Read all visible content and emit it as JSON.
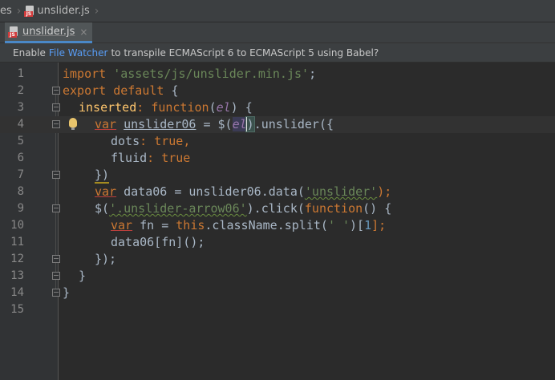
{
  "breadcrumb": {
    "parent": "es",
    "file": "unslider.js",
    "file_icon": "javascript-file-icon",
    "file_badge": "JS"
  },
  "tab": {
    "label": "unslider.js",
    "close": "×"
  },
  "notification": {
    "prefix": "Enable",
    "link": "File Watcher",
    "suffix": "to transpile ECMAScript 6 to ECMAScript 5 using Babel?"
  },
  "editor": {
    "line_numbers": [
      "1",
      "2",
      "3",
      "4",
      "5",
      "6",
      "7",
      "8",
      "9",
      "10",
      "11",
      "12",
      "13",
      "14",
      "15"
    ],
    "current_line": 4,
    "tokens": {
      "l1_import": "import",
      "l1_path": "'assets/js/unslider.min.js'",
      "l2_export": "export",
      "l2_default": "default",
      "l2_brace": "{",
      "l3_inserted": "inserted",
      "l3_colon": ":",
      "l3_function": "function",
      "l3_param": "el",
      "l3_rest": ") {",
      "l4_var": "var",
      "l4_name": "unslider06",
      "l4_eq": " = $(",
      "l4_el": "el",
      "l4_close": ")",
      "l4_call": ".unslider",
      "l4_open": "({",
      "l5_dots": "dots",
      "l5_true": "true",
      "l6_fluid": "fluid",
      "l6_true": "true",
      "l7_close": "})",
      "l8_var": "var",
      "l8_rest": " data06 = unslider06.",
      "l8_data": "data",
      "l8_arg": "'unslider'",
      "l8_end": ");",
      "l9_dollar": "$(",
      "l9_sel": "'.unslider-arrow06'",
      "l9_click": ").",
      "l9_clickfn": "click",
      "l9_func": "function",
      "l9_end": "() {",
      "l10_var": "var",
      "l10_fn": " fn = ",
      "l10_this": "this",
      "l10_class": ".className.split(",
      "l10_space": "' '",
      "l10_idx": "1",
      "l10_end": "];",
      "l11_text": "data06[fn]();",
      "l12_text": "});",
      "l13_text": "}",
      "l14_text": "}"
    }
  },
  "colors": {
    "background": "#2b2b2b",
    "keyword": "#cc7832",
    "string": "#6a8759",
    "function": "#ffc66d",
    "parameter": "#9876aa",
    "number": "#6897bb",
    "link": "#589df6"
  }
}
